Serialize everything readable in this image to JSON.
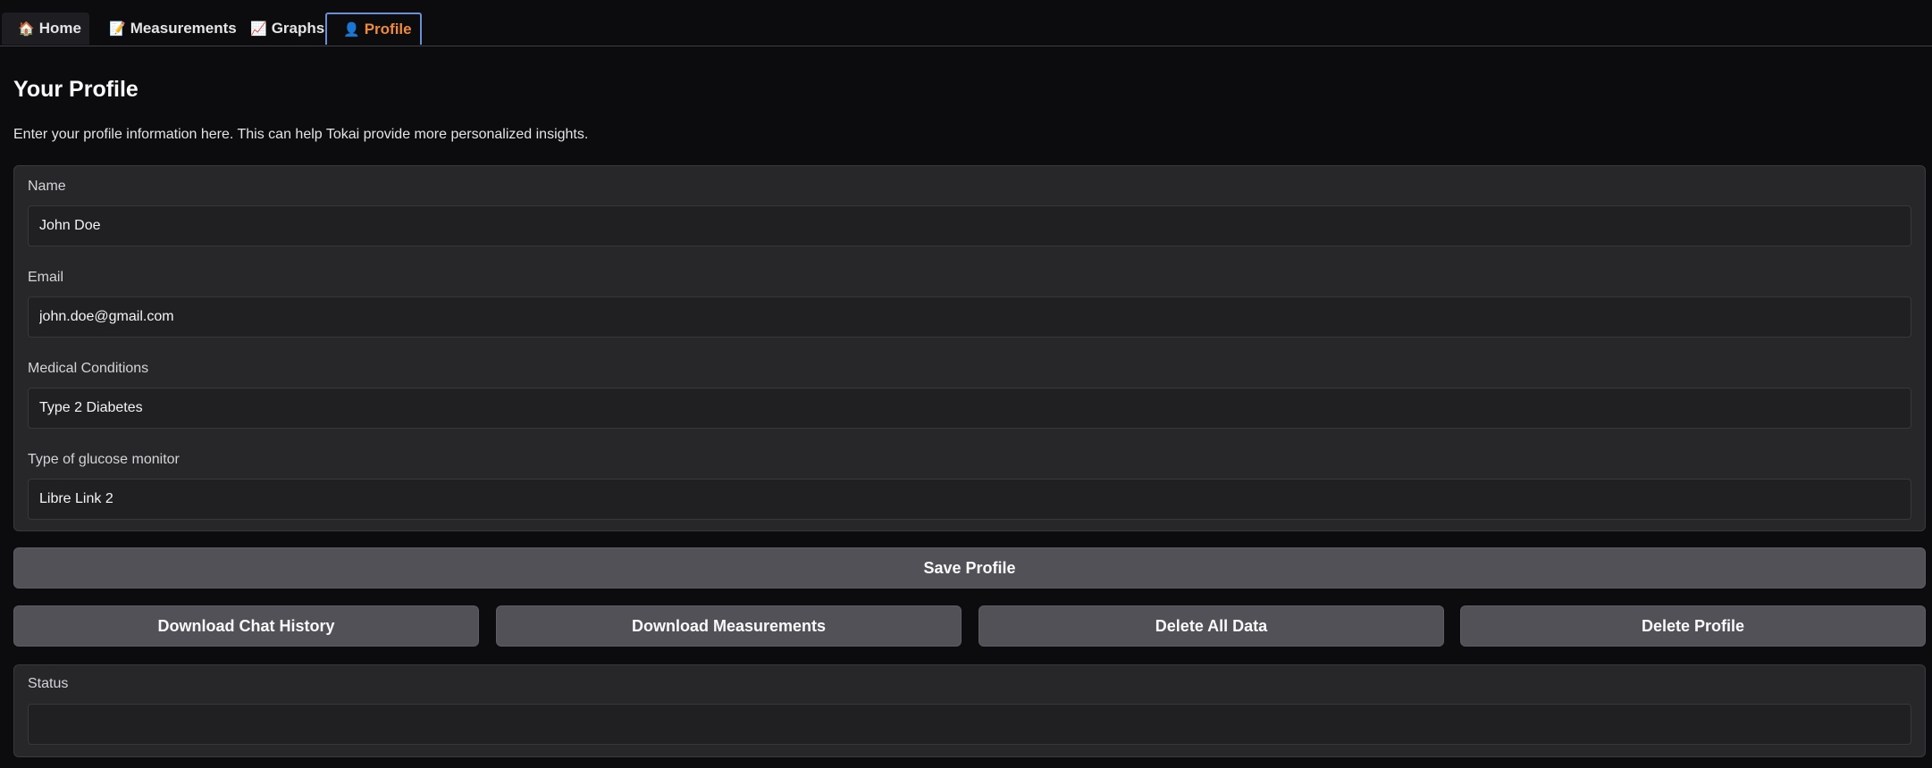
{
  "tabs": [
    {
      "icon": "🏠",
      "icon_name": "house-icon",
      "label": "Home"
    },
    {
      "icon": "📝",
      "icon_name": "memo-icon",
      "label": "Measurements"
    },
    {
      "icon": "📈",
      "icon_name": "chart-icon",
      "label": "Graphs"
    },
    {
      "icon": "👤",
      "icon_name": "user-icon",
      "label": "Profile",
      "active": true
    }
  ],
  "page": {
    "title": "Your Profile",
    "description": "Enter your profile information here. This can help Tokai provide more personalized insights."
  },
  "form": {
    "name": {
      "label": "Name",
      "value": "John Doe"
    },
    "email": {
      "label": "Email",
      "value": "john.doe@gmail.com"
    },
    "conditions": {
      "label": "Medical Conditions",
      "value": "Type 2 Diabetes"
    },
    "monitor": {
      "label": "Type of glucose monitor",
      "value": "Libre Link 2"
    }
  },
  "buttons": {
    "save": "Save Profile",
    "download_chat": "Download Chat History",
    "download_measurements": "Download Measurements",
    "delete_data": "Delete All Data",
    "delete_profile": "Delete Profile"
  },
  "status": {
    "label": "Status",
    "value": ""
  },
  "colors": {
    "background": "#0c0c0f",
    "panel": "#27272a",
    "button": "#515157",
    "active_tab_text": "#f08a3e",
    "active_tab_border": "#6b8fd6"
  }
}
